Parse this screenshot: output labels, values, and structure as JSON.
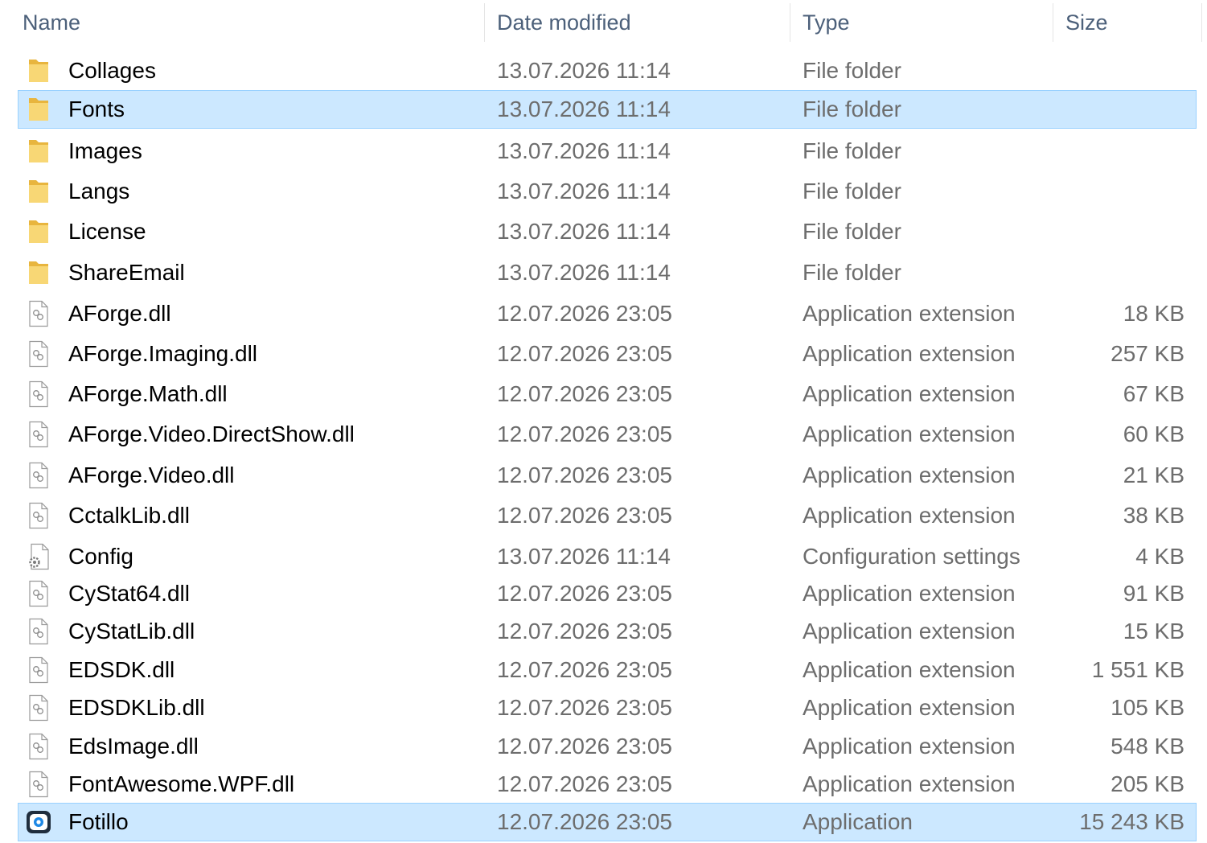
{
  "columns": {
    "name": "Name",
    "date_modified": "Date modified",
    "type": "Type",
    "size": "Size"
  },
  "colors": {
    "selection_bg": "#cce8ff",
    "selection_border": "#99d1ff",
    "folder": "#f8d775",
    "secondary_text": "#6d6d6d"
  },
  "rows": [
    {
      "name": "Collages",
      "date": "13.07.2026 11:14",
      "type": "File folder",
      "size": "",
      "icon": "folder-icon",
      "selected": false
    },
    {
      "name": "Fonts",
      "date": "13.07.2026 11:14",
      "type": "File folder",
      "size": "",
      "icon": "folder-icon",
      "selected": true
    },
    {
      "name": "Images",
      "date": "13.07.2026 11:14",
      "type": "File folder",
      "size": "",
      "icon": "folder-icon",
      "selected": false
    },
    {
      "name": "Langs",
      "date": "13.07.2026 11:14",
      "type": "File folder",
      "size": "",
      "icon": "folder-icon",
      "selected": false
    },
    {
      "name": "License",
      "date": "13.07.2026 11:14",
      "type": "File folder",
      "size": "",
      "icon": "folder-icon",
      "selected": false
    },
    {
      "name": "ShareEmail",
      "date": "13.07.2026 11:14",
      "type": "File folder",
      "size": "",
      "icon": "folder-icon",
      "selected": false
    },
    {
      "name": "AForge.dll",
      "date": "12.07.2026 23:05",
      "type": "Application extension",
      "size": "18 KB",
      "icon": "dll-file-icon",
      "selected": false
    },
    {
      "name": "AForge.Imaging.dll",
      "date": "12.07.2026 23:05",
      "type": "Application extension",
      "size": "257 KB",
      "icon": "dll-file-icon",
      "selected": false
    },
    {
      "name": "AForge.Math.dll",
      "date": "12.07.2026 23:05",
      "type": "Application extension",
      "size": "67 KB",
      "icon": "dll-file-icon",
      "selected": false
    },
    {
      "name": "AForge.Video.DirectShow.dll",
      "date": "12.07.2026 23:05",
      "type": "Application extension",
      "size": "60 KB",
      "icon": "dll-file-icon",
      "selected": false
    },
    {
      "name": "AForge.Video.dll",
      "date": "12.07.2026 23:05",
      "type": "Application extension",
      "size": "21 KB",
      "icon": "dll-file-icon",
      "selected": false
    },
    {
      "name": "CctalkLib.dll",
      "date": "12.07.2026 23:05",
      "type": "Application extension",
      "size": "38 KB",
      "icon": "dll-file-icon",
      "selected": false
    },
    {
      "name": "Config",
      "date": "13.07.2026 11:14",
      "type": "Configuration settings",
      "size": "4 KB",
      "icon": "config-file-icon",
      "selected": false
    },
    {
      "name": "CyStat64.dll",
      "date": "12.07.2026 23:05",
      "type": "Application extension",
      "size": "91 KB",
      "icon": "dll-file-icon",
      "selected": false
    },
    {
      "name": "CyStatLib.dll",
      "date": "12.07.2026 23:05",
      "type": "Application extension",
      "size": "15 KB",
      "icon": "dll-file-icon",
      "selected": false
    },
    {
      "name": "EDSDK.dll",
      "date": "12.07.2026 23:05",
      "type": "Application extension",
      "size": "1 551 KB",
      "icon": "dll-file-icon",
      "selected": false
    },
    {
      "name": "EDSDKLib.dll",
      "date": "12.07.2026 23:05",
      "type": "Application extension",
      "size": "105 KB",
      "icon": "dll-file-icon",
      "selected": false
    },
    {
      "name": "EdsImage.dll",
      "date": "12.07.2026 23:05",
      "type": "Application extension",
      "size": "548 KB",
      "icon": "dll-file-icon",
      "selected": false
    },
    {
      "name": "FontAwesome.WPF.dll",
      "date": "12.07.2026 23:05",
      "type": "Application extension",
      "size": "205 KB",
      "icon": "dll-file-icon",
      "selected": false
    },
    {
      "name": "Fotillo",
      "date": "12.07.2026 23:05",
      "type": "Application",
      "size": "15 243 KB",
      "icon": "fotillo-app-icon",
      "selected": true
    }
  ]
}
